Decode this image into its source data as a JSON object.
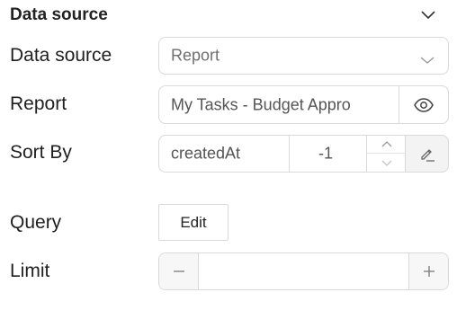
{
  "section": {
    "title": "Data source",
    "icon": "chevron-down-icon"
  },
  "rows": {
    "data_source": {
      "label": "Data source",
      "selected": "Report",
      "icon": "chevron-down-icon"
    },
    "report": {
      "label": "Report",
      "value": "My Tasks - Budget Appro",
      "icon": "eye-icon"
    },
    "sort_by": {
      "label": "Sort By",
      "field": "createdAt",
      "order": "-1",
      "icons": [
        "chevron-up-icon",
        "chevron-down-icon",
        "edit-pencil-icon"
      ]
    },
    "query": {
      "label": "Query",
      "button_label": "Edit"
    },
    "limit": {
      "label": "Limit",
      "value": "",
      "icons": [
        "minus-icon",
        "plus-icon"
      ]
    }
  },
  "colors": {
    "border": "#d9d9d9",
    "muted_text": "#6f6f6f",
    "edit_bg": "#f3f3f3"
  }
}
